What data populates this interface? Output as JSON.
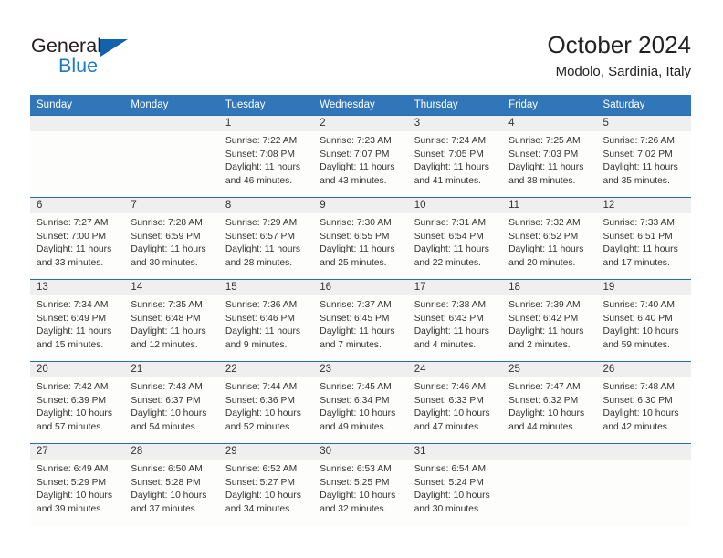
{
  "brand": {
    "name_part1": "General",
    "name_part2": "Blue",
    "accent": "#1263ab",
    "blue_text": "#1a7ac7"
  },
  "header": {
    "title": "October 2024",
    "subtitle": "Modolo, Sardinia, Italy"
  },
  "calendar": {
    "header_bg": "#3076b8",
    "row_border": "#2a6bad",
    "daynum_bg": "#efefef",
    "weekdays": [
      "Sunday",
      "Monday",
      "Tuesday",
      "Wednesday",
      "Thursday",
      "Friday",
      "Saturday"
    ],
    "labels": {
      "sunrise": "Sunrise:",
      "sunset": "Sunset:",
      "daylight": "Daylight:"
    },
    "weeks": [
      [
        {
          "day": ""
        },
        {
          "day": ""
        },
        {
          "day": "1",
          "sunrise": "Sunrise: 7:22 AM",
          "sunset": "Sunset: 7:08 PM",
          "daylight": "Daylight: 11 hours and 46 minutes."
        },
        {
          "day": "2",
          "sunrise": "Sunrise: 7:23 AM",
          "sunset": "Sunset: 7:07 PM",
          "daylight": "Daylight: 11 hours and 43 minutes."
        },
        {
          "day": "3",
          "sunrise": "Sunrise: 7:24 AM",
          "sunset": "Sunset: 7:05 PM",
          "daylight": "Daylight: 11 hours and 41 minutes."
        },
        {
          "day": "4",
          "sunrise": "Sunrise: 7:25 AM",
          "sunset": "Sunset: 7:03 PM",
          "daylight": "Daylight: 11 hours and 38 minutes."
        },
        {
          "day": "5",
          "sunrise": "Sunrise: 7:26 AM",
          "sunset": "Sunset: 7:02 PM",
          "daylight": "Daylight: 11 hours and 35 minutes."
        }
      ],
      [
        {
          "day": "6",
          "sunrise": "Sunrise: 7:27 AM",
          "sunset": "Sunset: 7:00 PM",
          "daylight": "Daylight: 11 hours and 33 minutes."
        },
        {
          "day": "7",
          "sunrise": "Sunrise: 7:28 AM",
          "sunset": "Sunset: 6:59 PM",
          "daylight": "Daylight: 11 hours and 30 minutes."
        },
        {
          "day": "8",
          "sunrise": "Sunrise: 7:29 AM",
          "sunset": "Sunset: 6:57 PM",
          "daylight": "Daylight: 11 hours and 28 minutes."
        },
        {
          "day": "9",
          "sunrise": "Sunrise: 7:30 AM",
          "sunset": "Sunset: 6:55 PM",
          "daylight": "Daylight: 11 hours and 25 minutes."
        },
        {
          "day": "10",
          "sunrise": "Sunrise: 7:31 AM",
          "sunset": "Sunset: 6:54 PM",
          "daylight": "Daylight: 11 hours and 22 minutes."
        },
        {
          "day": "11",
          "sunrise": "Sunrise: 7:32 AM",
          "sunset": "Sunset: 6:52 PM",
          "daylight": "Daylight: 11 hours and 20 minutes."
        },
        {
          "day": "12",
          "sunrise": "Sunrise: 7:33 AM",
          "sunset": "Sunset: 6:51 PM",
          "daylight": "Daylight: 11 hours and 17 minutes."
        }
      ],
      [
        {
          "day": "13",
          "sunrise": "Sunrise: 7:34 AM",
          "sunset": "Sunset: 6:49 PM",
          "daylight": "Daylight: 11 hours and 15 minutes."
        },
        {
          "day": "14",
          "sunrise": "Sunrise: 7:35 AM",
          "sunset": "Sunset: 6:48 PM",
          "daylight": "Daylight: 11 hours and 12 minutes."
        },
        {
          "day": "15",
          "sunrise": "Sunrise: 7:36 AM",
          "sunset": "Sunset: 6:46 PM",
          "daylight": "Daylight: 11 hours and 9 minutes."
        },
        {
          "day": "16",
          "sunrise": "Sunrise: 7:37 AM",
          "sunset": "Sunset: 6:45 PM",
          "daylight": "Daylight: 11 hours and 7 minutes."
        },
        {
          "day": "17",
          "sunrise": "Sunrise: 7:38 AM",
          "sunset": "Sunset: 6:43 PM",
          "daylight": "Daylight: 11 hours and 4 minutes."
        },
        {
          "day": "18",
          "sunrise": "Sunrise: 7:39 AM",
          "sunset": "Sunset: 6:42 PM",
          "daylight": "Daylight: 11 hours and 2 minutes."
        },
        {
          "day": "19",
          "sunrise": "Sunrise: 7:40 AM",
          "sunset": "Sunset: 6:40 PM",
          "daylight": "Daylight: 10 hours and 59 minutes."
        }
      ],
      [
        {
          "day": "20",
          "sunrise": "Sunrise: 7:42 AM",
          "sunset": "Sunset: 6:39 PM",
          "daylight": "Daylight: 10 hours and 57 minutes."
        },
        {
          "day": "21",
          "sunrise": "Sunrise: 7:43 AM",
          "sunset": "Sunset: 6:37 PM",
          "daylight": "Daylight: 10 hours and 54 minutes."
        },
        {
          "day": "22",
          "sunrise": "Sunrise: 7:44 AM",
          "sunset": "Sunset: 6:36 PM",
          "daylight": "Daylight: 10 hours and 52 minutes."
        },
        {
          "day": "23",
          "sunrise": "Sunrise: 7:45 AM",
          "sunset": "Sunset: 6:34 PM",
          "daylight": "Daylight: 10 hours and 49 minutes."
        },
        {
          "day": "24",
          "sunrise": "Sunrise: 7:46 AM",
          "sunset": "Sunset: 6:33 PM",
          "daylight": "Daylight: 10 hours and 47 minutes."
        },
        {
          "day": "25",
          "sunrise": "Sunrise: 7:47 AM",
          "sunset": "Sunset: 6:32 PM",
          "daylight": "Daylight: 10 hours and 44 minutes."
        },
        {
          "day": "26",
          "sunrise": "Sunrise: 7:48 AM",
          "sunset": "Sunset: 6:30 PM",
          "daylight": "Daylight: 10 hours and 42 minutes."
        }
      ],
      [
        {
          "day": "27",
          "sunrise": "Sunrise: 6:49 AM",
          "sunset": "Sunset: 5:29 PM",
          "daylight": "Daylight: 10 hours and 39 minutes."
        },
        {
          "day": "28",
          "sunrise": "Sunrise: 6:50 AM",
          "sunset": "Sunset: 5:28 PM",
          "daylight": "Daylight: 10 hours and 37 minutes."
        },
        {
          "day": "29",
          "sunrise": "Sunrise: 6:52 AM",
          "sunset": "Sunset: 5:27 PM",
          "daylight": "Daylight: 10 hours and 34 minutes."
        },
        {
          "day": "30",
          "sunrise": "Sunrise: 6:53 AM",
          "sunset": "Sunset: 5:25 PM",
          "daylight": "Daylight: 10 hours and 32 minutes."
        },
        {
          "day": "31",
          "sunrise": "Sunrise: 6:54 AM",
          "sunset": "Sunset: 5:24 PM",
          "daylight": "Daylight: 10 hours and 30 minutes."
        },
        {
          "day": ""
        },
        {
          "day": ""
        }
      ]
    ]
  }
}
